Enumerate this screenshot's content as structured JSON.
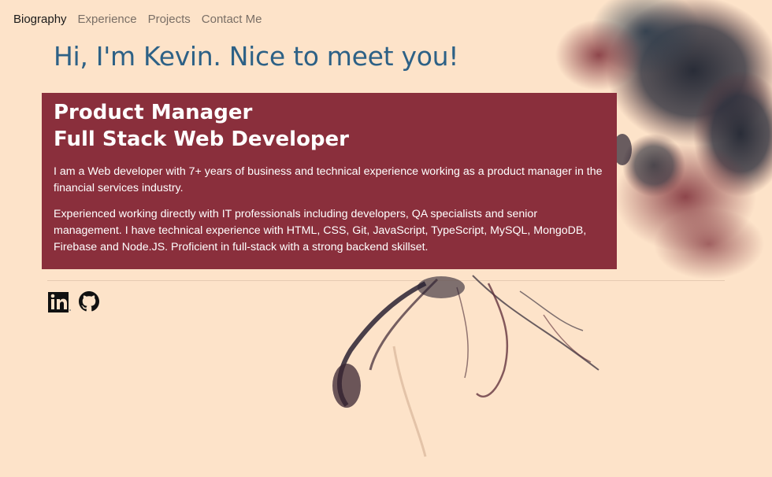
{
  "nav": {
    "items": [
      {
        "label": "Biography",
        "active": true
      },
      {
        "label": "Experience",
        "active": false
      },
      {
        "label": "Projects",
        "active": false
      },
      {
        "label": "Contact Me",
        "active": false
      }
    ]
  },
  "hero": {
    "greeting": "Hi, I'm Kevin. Nice to meet you!"
  },
  "bio": {
    "role_line1": "Product Manager",
    "role_line2": "Full Stack Web Developer",
    "paragraph1": "I am a Web developer with 7+ years of business and technical experience working as a product manager in the financial services industry.",
    "paragraph2": "Experienced working directly with IT professionals including developers, QA specialists and senior management. I have technical experience with HTML, CSS, Git, JavaScript, TypeScript, MySQL, MongoDB, Firebase and Node.JS. Proficient in full-stack with a strong backend skillset."
  },
  "social": {
    "icons": [
      "linkedin-icon",
      "github-icon"
    ]
  },
  "colors": {
    "background": "#fde3c9",
    "accent_box": "#8a2f3c",
    "greeting_text": "#2d6186",
    "ink": "#2a2535"
  }
}
